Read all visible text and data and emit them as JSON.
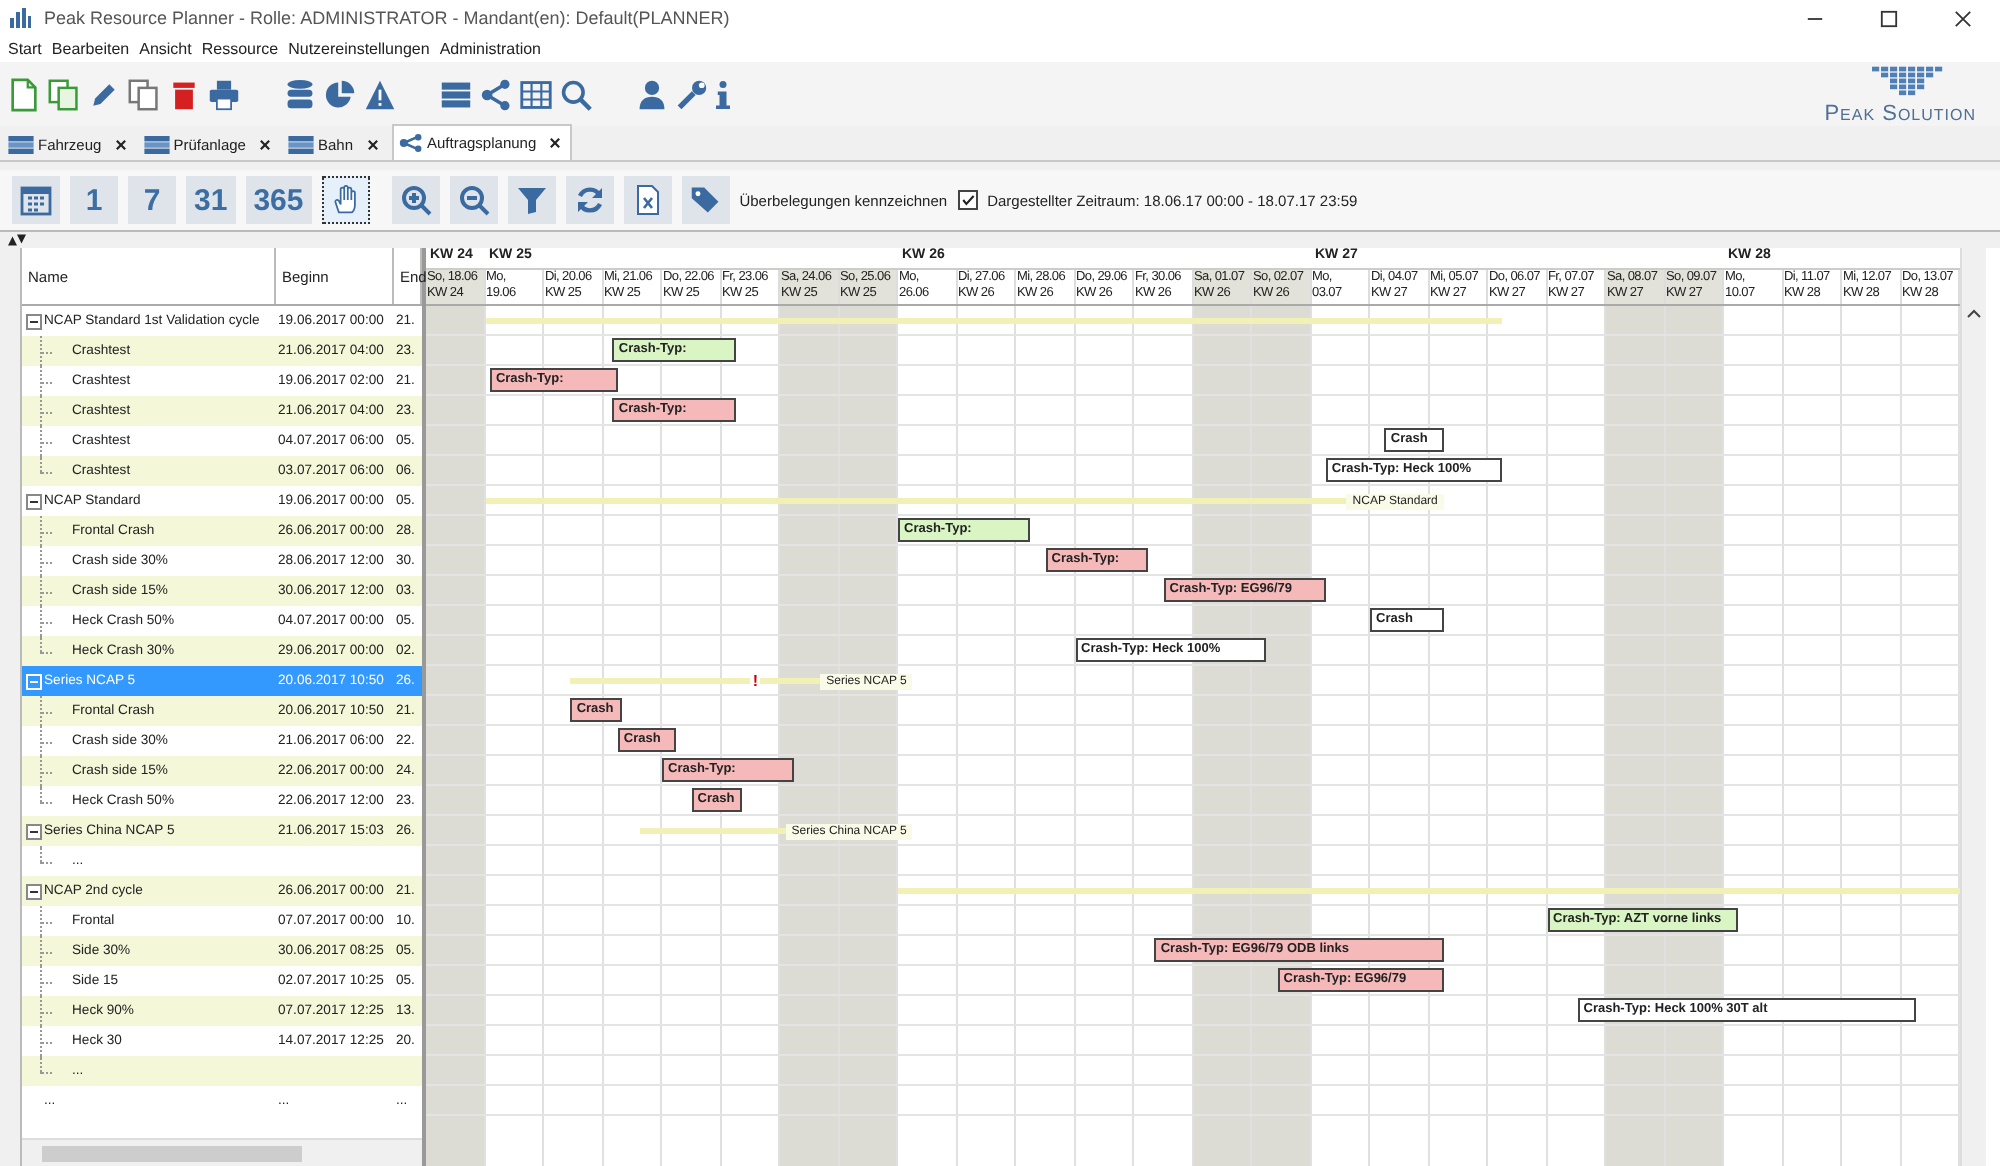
{
  "window": {
    "title": "Peak Resource Planner - Rolle: ADMINISTRATOR - Mandant(en): Default(PLANNER)"
  },
  "menu": [
    "Start",
    "Bearbeiten",
    "Ansicht",
    "Ressource",
    "Nutzereinstellungen",
    "Administration"
  ],
  "logo": {
    "text": "Peak Solution"
  },
  "tabs": [
    {
      "label": "Fahrzeug",
      "kind": "list",
      "selected": false
    },
    {
      "label": "Prüfanlage",
      "kind": "list",
      "selected": false
    },
    {
      "label": "Bahn",
      "kind": "list",
      "selected": false
    },
    {
      "label": "Auftragsplanung",
      "kind": "planning",
      "selected": true
    }
  ],
  "gantt_toolbar": {
    "scale_buttons": [
      {
        "label": "1"
      },
      {
        "label": "7"
      },
      {
        "label": "31"
      },
      {
        "label": "365"
      }
    ],
    "hand_tool": {
      "selected": true
    },
    "overbooking": {
      "label": "Überbelegungen kennzeichnen",
      "checked": true
    },
    "range": "Dargestellter Zeitraum: 18.06.17 00:00 - 18.07.17 23:59"
  },
  "tree": {
    "columns": [
      "Name",
      "Beginn",
      "End"
    ],
    "items": [
      {
        "name": "NCAP Standard 1st Validation cycle",
        "begin": "19.06.2017 00:00",
        "end": "21.",
        "selected": false,
        "expanded": true,
        "bar": {
          "kind": "summary"
        },
        "children": [
          {
            "name": "Crashtest",
            "begin": "21.06.2017 04:00",
            "end": "23.",
            "selected": false,
            "bar": {
              "kind": "task",
              "label": "Crash-Typ:",
              "color": "#d9f5c4"
            }
          },
          {
            "name": "Crashtest",
            "begin": "19.06.2017 02:00",
            "end": "21.",
            "selected": false,
            "bar": {
              "kind": "task",
              "label": "Crash-Typ:",
              "color": "#f6b9b9"
            }
          },
          {
            "name": "Crashtest",
            "begin": "21.06.2017 04:00",
            "end": "23.",
            "selected": false,
            "bar": {
              "kind": "task",
              "label": "Crash-Typ:",
              "color": "#f6b9b9"
            }
          },
          {
            "name": "Crashtest",
            "begin": "04.07.2017 06:00",
            "end": "05.",
            "selected": false,
            "bar": {
              "kind": "task",
              "label": "Crash",
              "color": "#ffffff"
            }
          },
          {
            "name": "Crashtest",
            "begin": "03.07.2017 06:00",
            "end": "06.",
            "selected": false,
            "bar": {
              "kind": "task",
              "label": "Crash-Typ: Heck 100%",
              "color": "#ffffff"
            }
          }
        ]
      },
      {
        "name": "NCAP Standard",
        "begin": "19.06.2017 00:00",
        "end": "05.",
        "selected": false,
        "expanded": true,
        "bar": {
          "kind": "summary",
          "label": "NCAP Standard"
        },
        "children": [
          {
            "name": "Frontal Crash",
            "begin": "26.06.2017 00:00",
            "end": "28.",
            "selected": false,
            "bar": {
              "kind": "task",
              "label": "Crash-Typ:",
              "color": "#d9f5c4"
            }
          },
          {
            "name": "Crash side 30%",
            "begin": "28.06.2017 12:00",
            "end": "30.",
            "selected": false,
            "bar": {
              "kind": "task",
              "label": "Crash-Typ:",
              "color": "#f6b9b9"
            }
          },
          {
            "name": "Crash side 15%",
            "begin": "30.06.2017 12:00",
            "end": "03.",
            "selected": false,
            "bar": {
              "kind": "task",
              "label": "Crash-Typ: EG96/79",
              "color": "#f6b9b9"
            }
          },
          {
            "name": "Heck Crash 50%",
            "begin": "04.07.2017 00:00",
            "end": "05.",
            "selected": false,
            "bar": {
              "kind": "task",
              "label": "Crash",
              "color": "#ffffff"
            }
          },
          {
            "name": "Heck Crash 30%",
            "begin": "29.06.2017 00:00",
            "end": "02.",
            "selected": false,
            "bar": {
              "kind": "task",
              "label": "Crash-Typ: Heck 100%",
              "color": "#ffffff"
            }
          }
        ]
      },
      {
        "name": "Series NCAP 5",
        "begin": "20.06.2017 10:50",
        "end": "26.",
        "selected": true,
        "expanded": true,
        "bar": {
          "kind": "summary",
          "label": "Series NCAP 5",
          "marker": "!"
        },
        "children": [
          {
            "name": "Frontal Crash",
            "begin": "20.06.2017 10:50",
            "end": "21.",
            "selected": false,
            "bar": {
              "kind": "task",
              "label": "Crash",
              "color": "#f6b9b9"
            }
          },
          {
            "name": "Crash side 30%",
            "begin": "21.06.2017 06:00",
            "end": "22.",
            "selected": false,
            "bar": {
              "kind": "task",
              "label": "Crash",
              "color": "#f6b9b9"
            }
          },
          {
            "name": "Crash side 15%",
            "begin": "22.06.2017 00:00",
            "end": "24.",
            "selected": false,
            "bar": {
              "kind": "task",
              "label": "Crash-Typ:",
              "color": "#f6b9b9"
            }
          },
          {
            "name": "Heck Crash 50%",
            "begin": "22.06.2017 12:00",
            "end": "23.",
            "selected": false,
            "bar": {
              "kind": "task",
              "label": "Crash",
              "color": "#f6b9b9"
            }
          }
        ]
      },
      {
        "name": "Series China NCAP 5",
        "begin": "21.06.2017 15:03",
        "end": "26.",
        "selected": false,
        "expanded": true,
        "bar": {
          "kind": "summary",
          "label": "Series China NCAP 5"
        },
        "children": [
          {
            "name": "...",
            "selected": false
          }
        ]
      },
      {
        "name": "NCAP 2nd cycle",
        "begin": "26.06.2017 00:00",
        "end": "21.",
        "selected": false,
        "expanded": true,
        "bar": {
          "kind": "summary"
        },
        "children": [
          {
            "name": "Frontal",
            "begin": "07.07.2017 00:00",
            "end": "10.",
            "selected": false,
            "bar": {
              "kind": "task",
              "label": "Crash-Typ: AZT vorne links",
              "color": "#d9f5c4"
            }
          },
          {
            "name": "Side 30%",
            "begin": "30.06.2017 08:25",
            "end": "05.",
            "selected": false,
            "bar": {
              "kind": "task",
              "label": "Crash-Typ: EG96/79 ODB links",
              "color": "#f6b9b9"
            }
          },
          {
            "name": "Side 15",
            "begin": "02.07.2017 10:25",
            "end": "05.",
            "selected": false,
            "bar": {
              "kind": "task",
              "label": "Crash-Typ: EG96/79",
              "color": "#f6b9b9"
            }
          },
          {
            "name": "Heck 90%",
            "begin": "07.07.2017 12:25",
            "end": "13.",
            "selected": false,
            "bar": {
              "kind": "task",
              "label": "Crash-Typ: Heck 100% 30T alt",
              "color": "#ffffff"
            }
          },
          {
            "name": "Heck 30",
            "begin": "14.07.2017 12:25",
            "end": "20.",
            "selected": false
          },
          {
            "name": "...",
            "selected": false
          }
        ]
      },
      {
        "name": "...",
        "begin": "...",
        "end": "...",
        "selected": false
      }
    ]
  },
  "timeline": {
    "days": [
      {
        "week_label": "KW 24",
        "line1": "So, 18.06",
        "line2": "KW 24",
        "weekend": true
      },
      {
        "week_label": "KW 25",
        "line1": "Mo,",
        "line2": "19.06",
        "weekend": false
      },
      {
        "line1": "Di, 20.06",
        "line2": "KW 25",
        "weekend": false
      },
      {
        "line1": "Mi, 21.06",
        "line2": "KW 25",
        "weekend": false
      },
      {
        "line1": "Do, 22.06",
        "line2": "KW 25",
        "weekend": false
      },
      {
        "line1": "Fr, 23.06",
        "line2": "KW 25",
        "weekend": false
      },
      {
        "line1": "Sa, 24.06",
        "line2": "KW 25",
        "weekend": true
      },
      {
        "line1": "So, 25.06",
        "line2": "KW 25",
        "weekend": true
      },
      {
        "week_label": "KW 26",
        "line1": "Mo,",
        "line2": "26.06",
        "weekend": false
      },
      {
        "line1": "Di, 27.06",
        "line2": "KW 26",
        "weekend": false
      },
      {
        "line1": "Mi, 28.06",
        "line2": "KW 26",
        "weekend": false
      },
      {
        "line1": "Do, 29.06",
        "line2": "KW 26",
        "weekend": false
      },
      {
        "line1": "Fr, 30.06",
        "line2": "KW 26",
        "weekend": false
      },
      {
        "line1": "Sa, 01.07",
        "line2": "KW 26",
        "weekend": true
      },
      {
        "line1": "So, 02.07",
        "line2": "KW 26",
        "weekend": true
      },
      {
        "week_label": "KW 27",
        "line1": "Mo,",
        "line2": "03.07",
        "weekend": false
      },
      {
        "line1": "Di, 04.07",
        "line2": "KW 27",
        "weekend": false
      },
      {
        "line1": "Mi, 05.07",
        "line2": "KW 27",
        "weekend": false
      },
      {
        "line1": "Do, 06.07",
        "line2": "KW 27",
        "weekend": false
      },
      {
        "line1": "Fr, 07.07",
        "line2": "KW 27",
        "weekend": false
      },
      {
        "line1": "Sa, 08.07",
        "line2": "KW 27",
        "weekend": true
      },
      {
        "line1": "So, 09.07",
        "line2": "KW 27",
        "weekend": true
      },
      {
        "week_label": "KW 28",
        "line1": "Mo,",
        "line2": "10.07",
        "weekend": false
      },
      {
        "line1": "Di, 11.07",
        "line2": "KW 28",
        "weekend": false
      },
      {
        "line1": "Mi, 12.07",
        "line2": "KW 28",
        "weekend": false
      },
      {
        "line1": "Do, 13.07",
        "line2": "KW 28",
        "weekend": false
      }
    ]
  }
}
